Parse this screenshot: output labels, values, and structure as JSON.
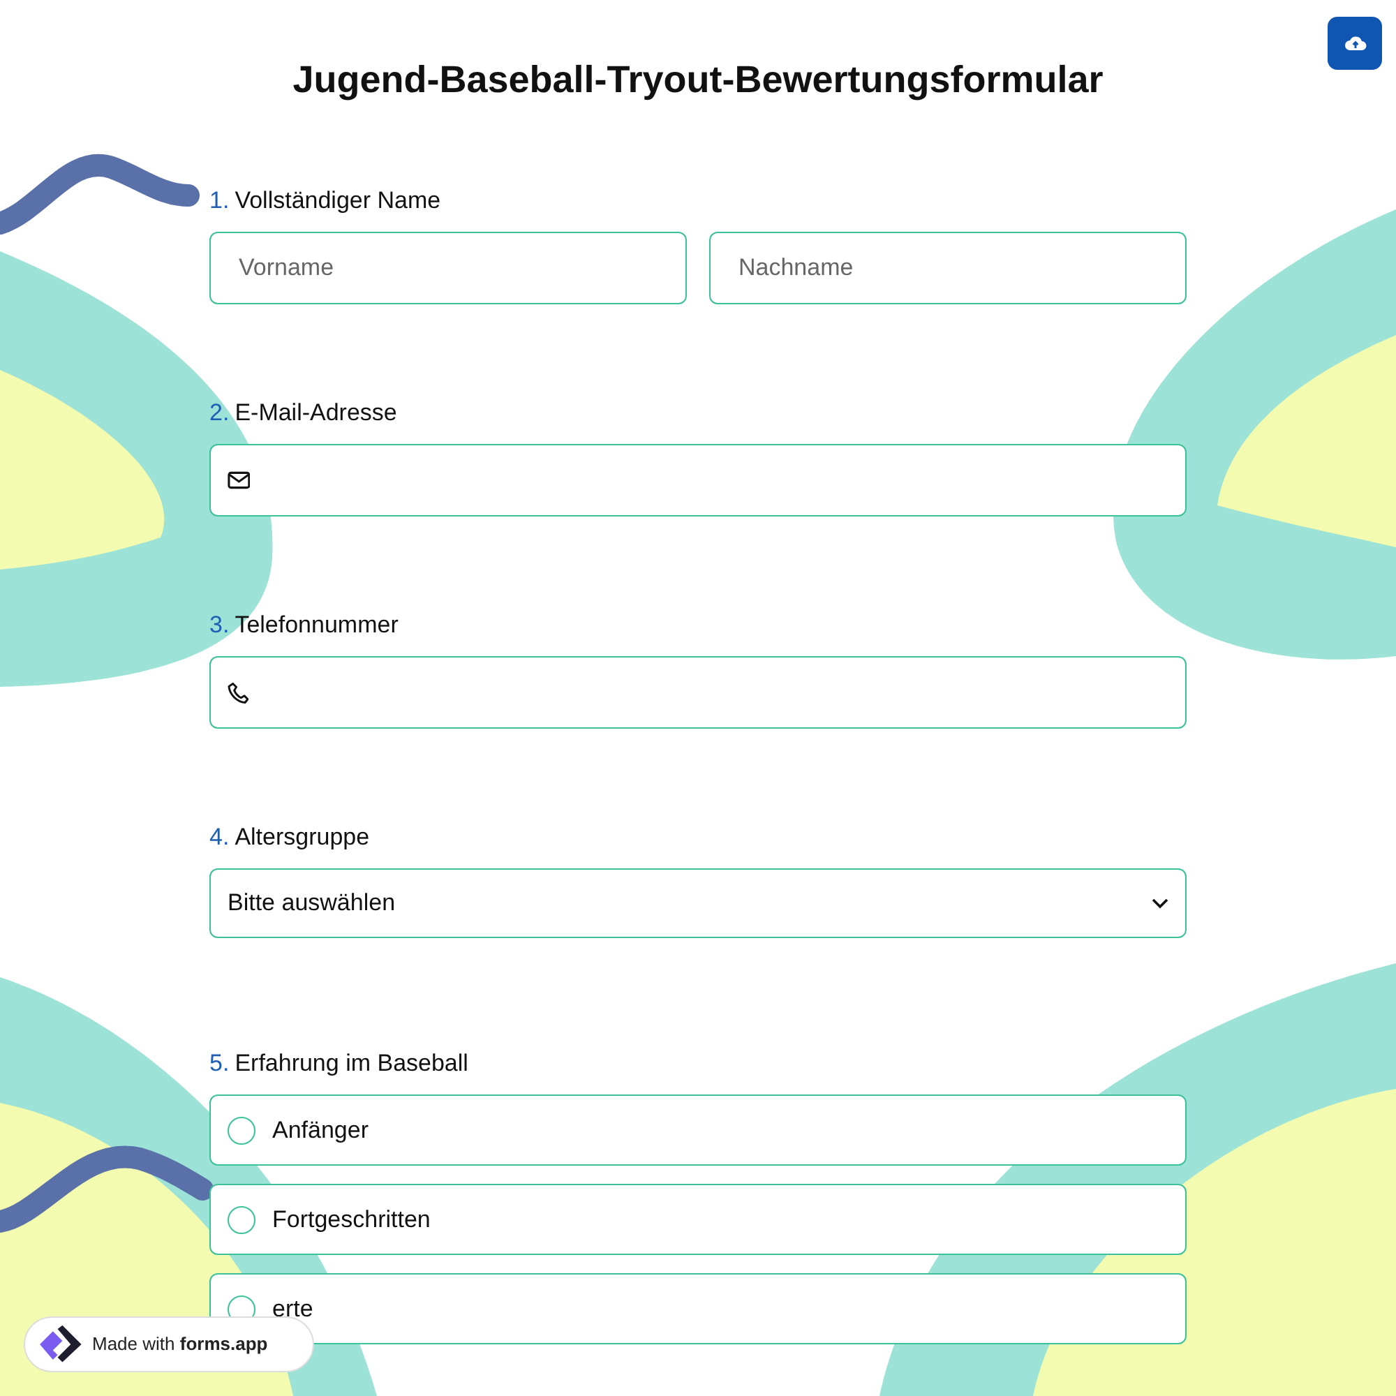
{
  "title": "Jugend-Baseball-Tryout-Bewertungsformular",
  "questions": [
    {
      "number": "1.",
      "label": "Vollständiger Name",
      "kind": "name",
      "fields": [
        {
          "placeholder": "Vorname"
        },
        {
          "placeholder": "Nachname"
        }
      ]
    },
    {
      "number": "2.",
      "label": "E-Mail-Adresse",
      "kind": "email"
    },
    {
      "number": "3.",
      "label": "Telefonnummer",
      "kind": "phone"
    },
    {
      "number": "4.",
      "label": "Altersgruppe",
      "kind": "select",
      "value": "Bitte auswählen"
    },
    {
      "number": "5.",
      "label": "Erfahrung im Baseball",
      "kind": "radio",
      "options": [
        {
          "label": "Anfänger",
          "selected": false
        },
        {
          "label": "Fortgeschritten",
          "selected": false
        },
        {
          "label": "erte",
          "selected": false
        }
      ]
    }
  ],
  "badge": {
    "text": "Made with **forms.app**"
  }
}
